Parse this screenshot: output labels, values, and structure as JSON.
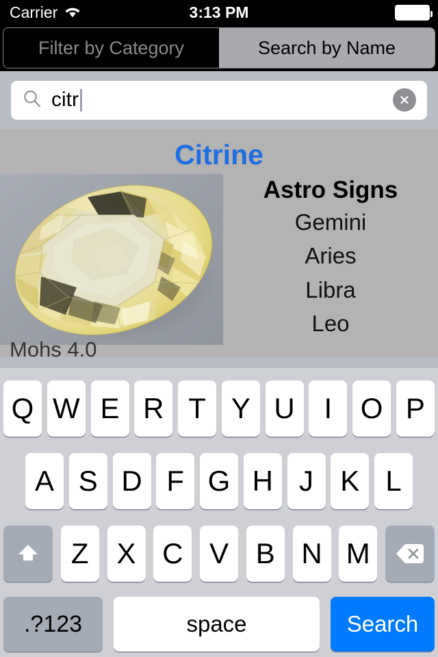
{
  "status_bar": {
    "carrier": "Carrier",
    "wifi_icon": "wifi-icon",
    "time": "3:13 PM",
    "battery_icon": "battery-full-icon"
  },
  "segmented_control": {
    "segments": [
      {
        "label": "Filter by Category",
        "selected": false
      },
      {
        "label": "Search by Name",
        "selected": true
      }
    ]
  },
  "search": {
    "icon": "search-icon",
    "value": "citr",
    "placeholder": "Search",
    "clear_icon": "clear-circle-icon"
  },
  "detail": {
    "title": "Citrine",
    "photo_alt": "citrine-gemstone-photo",
    "astro": {
      "heading": "Astro Signs",
      "signs": [
        "Gemini",
        "Aries",
        "Libra",
        "Leo"
      ]
    },
    "mohs": "Mohs 4.0"
  },
  "keyboard": {
    "row1": [
      "Q",
      "W",
      "E",
      "R",
      "T",
      "Y",
      "U",
      "I",
      "O",
      "P"
    ],
    "row2": [
      "A",
      "S",
      "D",
      "F",
      "G",
      "H",
      "J",
      "K",
      "L"
    ],
    "row3": [
      "Z",
      "X",
      "C",
      "V",
      "B",
      "N",
      "M"
    ],
    "shift_icon": "shift-arrow-icon",
    "delete_icon": "backspace-delete-icon",
    "numeric_label": ".?123",
    "space_label": "space",
    "search_label": "Search"
  },
  "colors": {
    "accent_blue": "#007aff",
    "title_blue": "#1f6fe0",
    "keyboard_bg": "#ced0d6",
    "content_bg": "#b3b3b3",
    "chrome_bg": "#b8bcc4",
    "status_bg": "#000000",
    "dark_key": "#a5abb5"
  }
}
